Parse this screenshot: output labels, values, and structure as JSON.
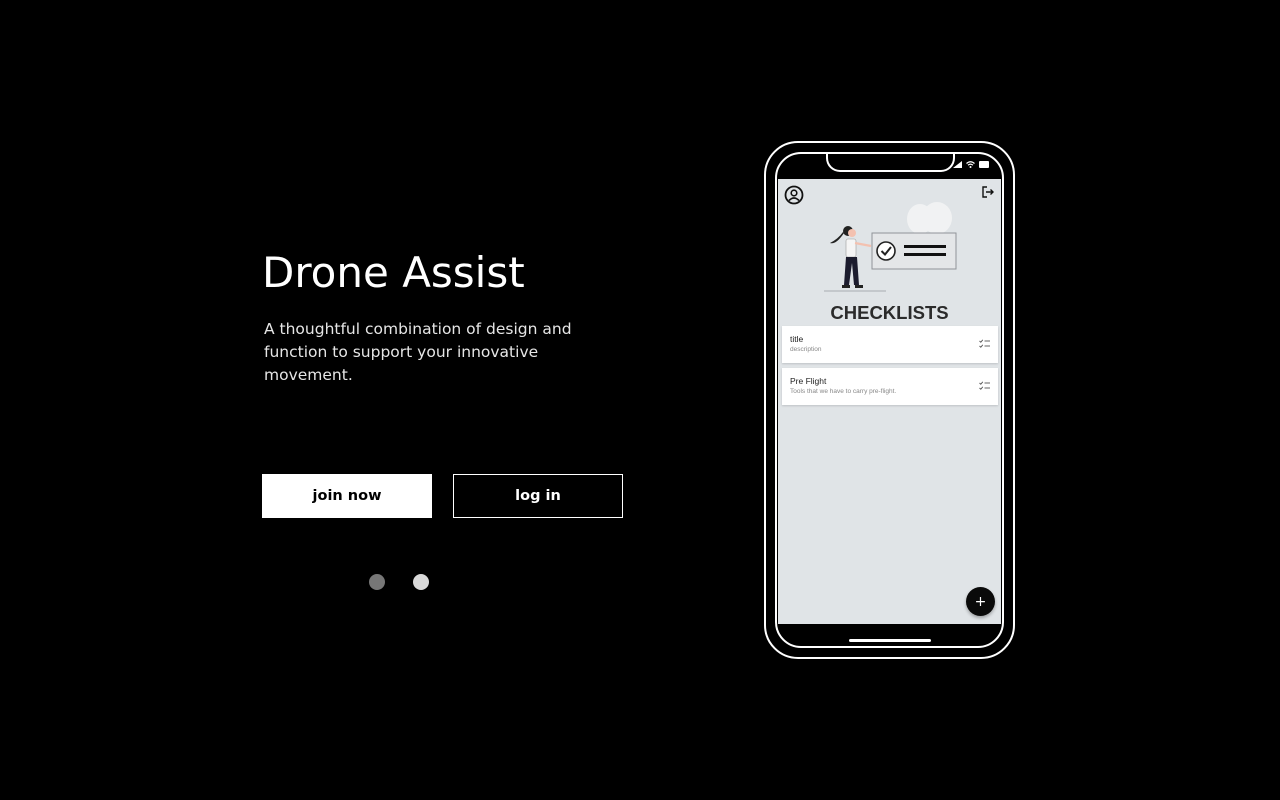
{
  "hero": {
    "title": "Drone Assist",
    "subtitle": "A thoughtful combination of design and function to support your innovative movement."
  },
  "actions": {
    "join_label": "join now",
    "login_label": "log in"
  },
  "carousel": {
    "dots": [
      "page-1",
      "page-2"
    ],
    "active_index": 1
  },
  "phone": {
    "status_icons": [
      "signal-icon",
      "wifi-icon",
      "battery-icon"
    ],
    "header_icons": [
      "profile-icon",
      "logout-icon"
    ],
    "screen_title": "CHECKLISTS",
    "checklists": [
      {
        "title": "title",
        "description": "description",
        "icon": "checklist-icon"
      },
      {
        "title": "Pre Flight",
        "description": "Tools that we have to carry pre-flight.",
        "icon": "checklist-icon"
      }
    ],
    "fab_label": "+"
  },
  "colors": {
    "background": "#000000",
    "screen": "#e0e4e7",
    "accent": "#ffffff"
  }
}
